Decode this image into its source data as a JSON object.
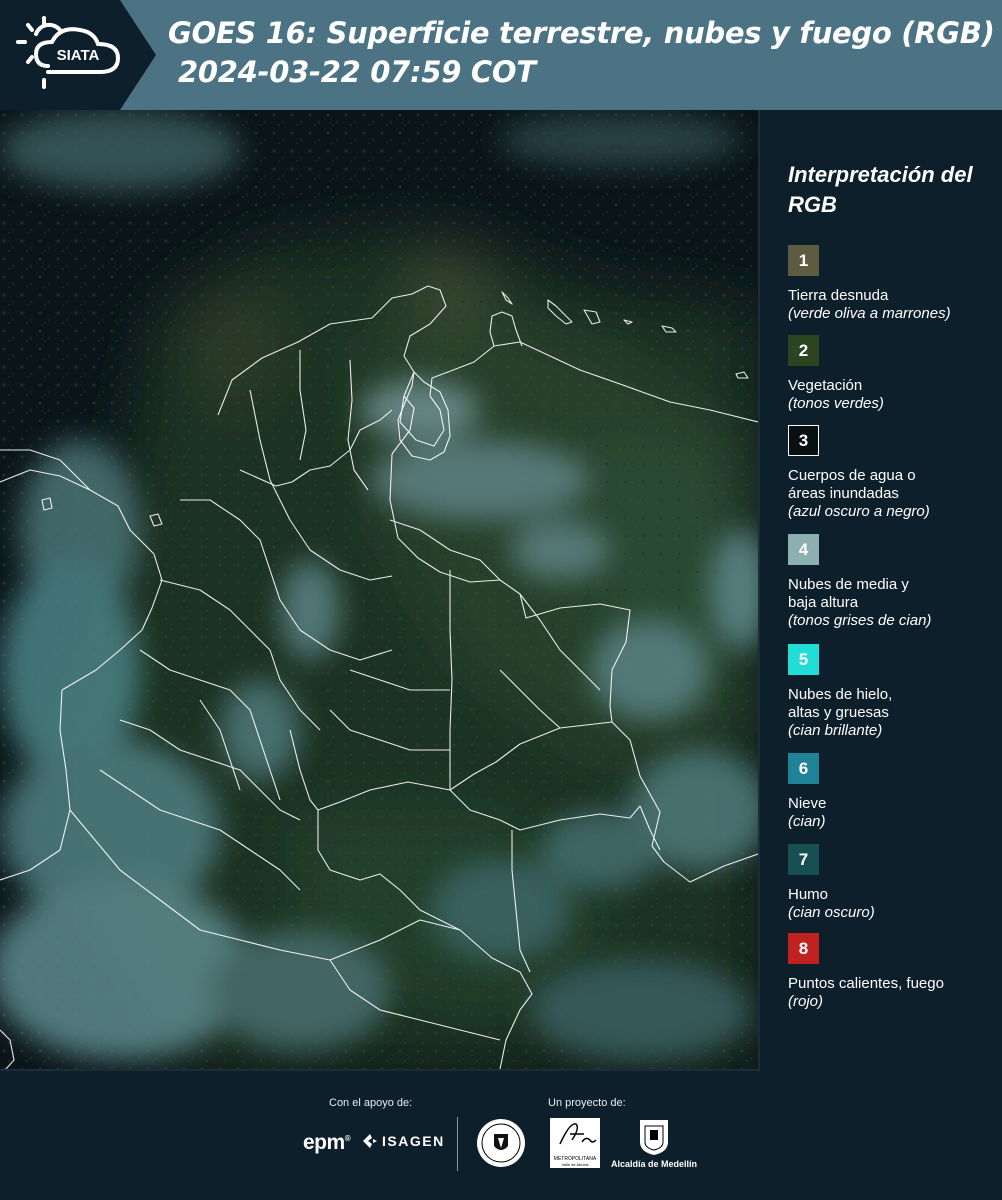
{
  "header": {
    "title_line1": "GOES 16: Superficie terrestre, nubes y fuego (RGB)",
    "title_line2": "2024-03-22 07:59 COT",
    "logo_text": "SIATA",
    "band_color": "#4b7383"
  },
  "legend": {
    "title": "Interpretación del RGB",
    "items": [
      {
        "number": "1",
        "label": "Tierra desnuda",
        "note": "(verde oliva a marrones)",
        "color": "#5e5c40"
      },
      {
        "number": "2",
        "label": "Vegetación",
        "note": "(tonos verdes)",
        "color": "#2c4421"
      },
      {
        "number": "3",
        "label": "Cuerpos de agua o áreas inundadas",
        "note": "(azul oscuro a negro)",
        "color": "#0a0f12"
      },
      {
        "number": "4",
        "label": "Nubes de media y baja altura",
        "note": "(tonos grises de cian)",
        "color": "#8cb0b0"
      },
      {
        "number": "5",
        "label": "Nubes de hielo, altas y gruesas",
        "note": "(cian brillante)",
        "color": "#22dcd8"
      },
      {
        "number": "6",
        "label": "Nieve",
        "note": "(cian)",
        "color": "#1f8397"
      },
      {
        "number": "7",
        "label": "Humo",
        "note": "(cian oscuro)",
        "color": "#174f52"
      },
      {
        "number": "8",
        "label": "Puntos calientes, fuego",
        "note": "(rojo)",
        "color": "#c0221f"
      }
    ]
  },
  "footer": {
    "support_label": "Con el apoyo de:",
    "project_label": "Un proyecto de:",
    "sponsors": {
      "epm": "epm",
      "isagen": "ISAGEN"
    },
    "area_logo_text": "METROPOLITANA",
    "area_logo_sub": "Valle de Aburrá",
    "alcaldia_label": "Alcaldía de Medellín"
  }
}
